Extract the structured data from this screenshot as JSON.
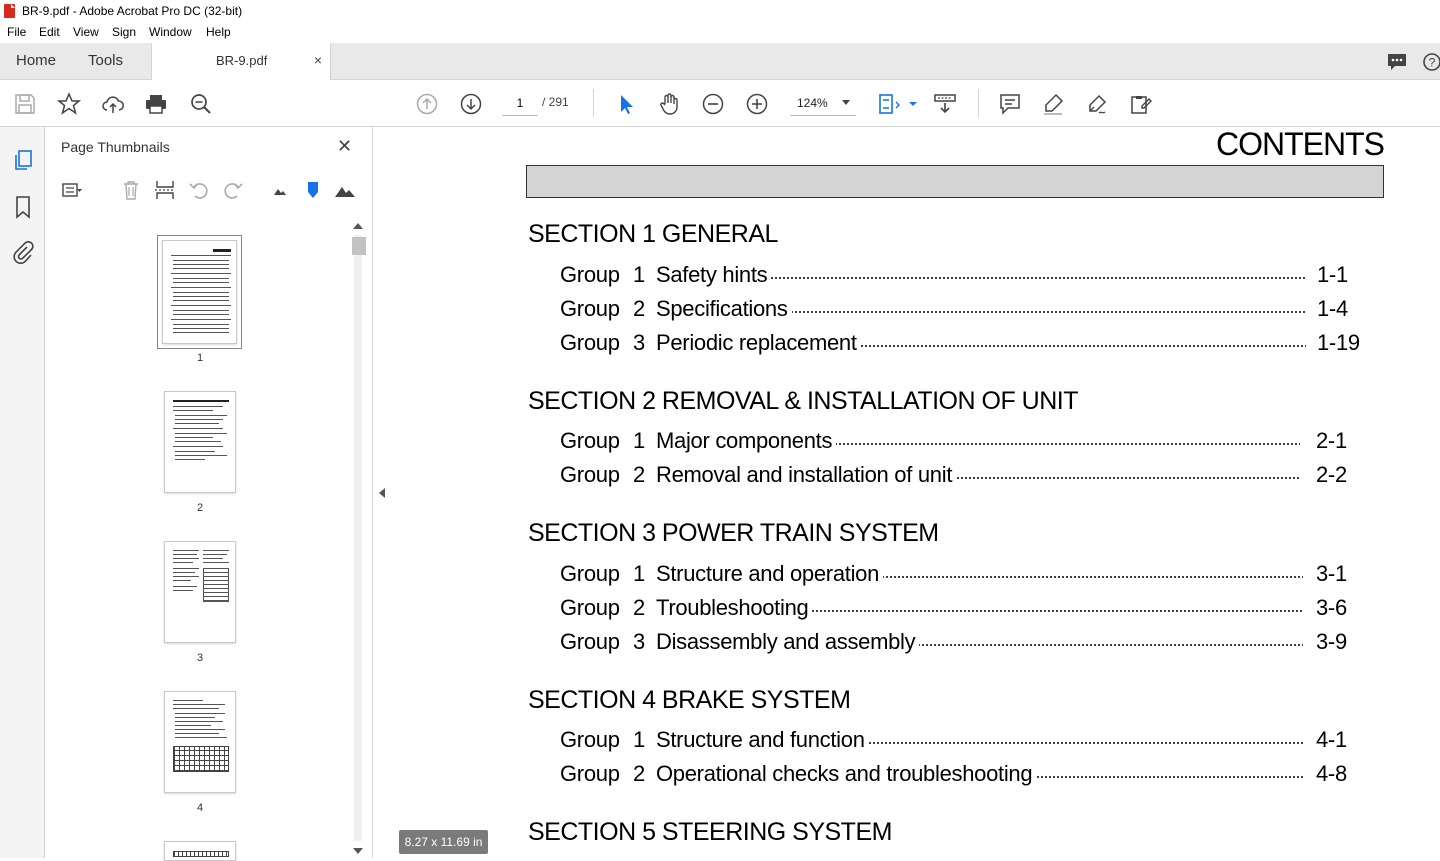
{
  "window": {
    "title": "BR-9.pdf - Adobe Acrobat Pro DC (32-bit)"
  },
  "menu": [
    "File",
    "Edit",
    "View",
    "Sign",
    "Window",
    "Help"
  ],
  "tabs": {
    "home": "Home",
    "tools": "Tools",
    "document": "BR-9.pdf",
    "close": "×"
  },
  "toolbar": {
    "page_current": "1",
    "page_total": "/ 291",
    "zoom": "124%"
  },
  "panel": {
    "title": "Page Thumbnails",
    "close": "✕",
    "thumbnails": [
      {
        "label": "1"
      },
      {
        "label": "2"
      },
      {
        "label": "3"
      },
      {
        "label": "4"
      }
    ]
  },
  "document": {
    "title": "CONTENTS",
    "sections": [
      {
        "heading": "SECTION 1  GENERAL",
        "groups": [
          {
            "group": "Group",
            "num": "1",
            "title": "Safety hints",
            "page": "1-1"
          },
          {
            "group": "Group",
            "num": "2",
            "title": "Specifications",
            "page": "1-4"
          },
          {
            "group": "Group",
            "num": "3",
            "title": "Periodic replacement",
            "page": "1-19"
          }
        ]
      },
      {
        "heading": "SECTION 2  REMOVAL & INSTALLATION OF UNIT",
        "groups": [
          {
            "group": "Group",
            "num": "1",
            "title": "Major components",
            "page": "2-1"
          },
          {
            "group": "Group",
            "num": "2",
            "title": "Removal and installation of unit",
            "page": "2-2"
          }
        ]
      },
      {
        "heading": "SECTION 3  POWER TRAIN SYSTEM",
        "groups": [
          {
            "group": "Group",
            "num": "1",
            "title": "Structure and operation",
            "page": "3-1"
          },
          {
            "group": "Group",
            "num": "2",
            "title": "Troubleshooting",
            "page": "3-6"
          },
          {
            "group": "Group",
            "num": "3",
            "title": "Disassembly and assembly",
            "page": "3-9"
          }
        ]
      },
      {
        "heading": "SECTION 4  BRAKE SYSTEM",
        "groups": [
          {
            "group": "Group",
            "num": "1",
            "title": "Structure and function",
            "page": "4-1"
          },
          {
            "group": "Group",
            "num": "2",
            "title": "Operational checks and troubleshooting",
            "page": "4-8"
          }
        ]
      },
      {
        "heading": "SECTION 5  STEERING SYSTEM",
        "groups": []
      }
    ]
  },
  "status": {
    "page_size": "8.27 x 11.69 in"
  },
  "colors": {
    "accent": "#1473e6",
    "pdf_red": "#d9291c"
  }
}
